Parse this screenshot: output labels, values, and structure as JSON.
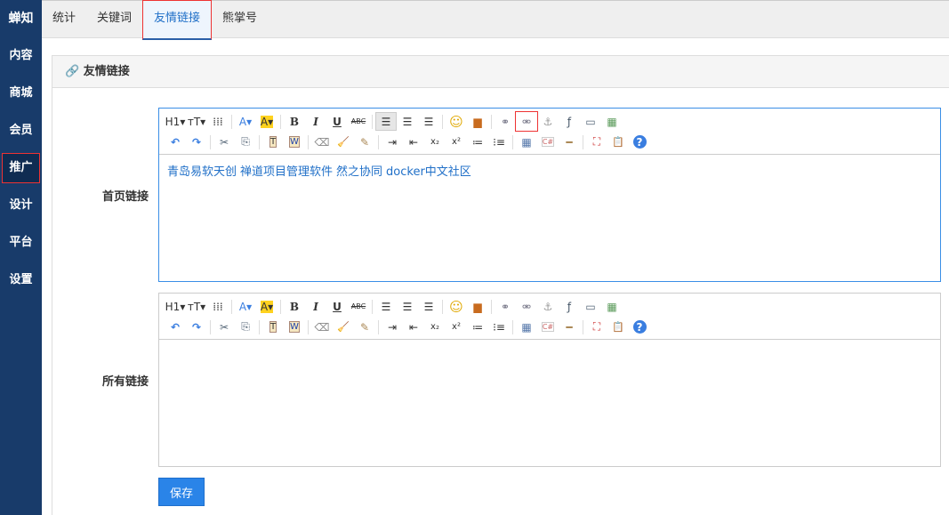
{
  "sidebar": {
    "brand": "蝉知",
    "items": [
      {
        "label": "内容"
      },
      {
        "label": "商城"
      },
      {
        "label": "会员"
      },
      {
        "label": "推广",
        "active": true
      },
      {
        "label": "设计"
      },
      {
        "label": "平台"
      },
      {
        "label": "设置"
      }
    ]
  },
  "topnav": {
    "tabs": [
      {
        "label": "统计"
      },
      {
        "label": "关键词"
      },
      {
        "label": "友情链接",
        "active": true
      },
      {
        "label": "熊掌号"
      }
    ]
  },
  "panel": {
    "title": "友情链接",
    "link_icon": "link-icon"
  },
  "form": {
    "home_label": "首页链接",
    "home_links": [
      "青岛易软天创",
      "禅道项目管理软件",
      "然之协同",
      "docker中文社区"
    ],
    "all_label": "所有链接",
    "save_label": "保存"
  },
  "toolbar": {
    "row1": [
      "heading",
      "font-size",
      "horizontal-rule",
      "|",
      "font-color",
      "highlight",
      "|",
      "bold",
      "italic",
      "underline",
      "strikethrough",
      "|",
      "align-left",
      "align-center",
      "align-right",
      "|",
      "emoticon",
      "image",
      "|",
      "link",
      "unlink",
      "anchor",
      "flash",
      "media",
      "image-manager"
    ],
    "row2": [
      "undo",
      "redo",
      "|",
      "cut",
      "copy",
      "|",
      "paste-text",
      "paste-word",
      "|",
      "eraser",
      "clear-format",
      "quick-format",
      "|",
      "indent",
      "outdent",
      "subscript",
      "superscript",
      "ordered-list",
      "unordered-list",
      "|",
      "table",
      "code",
      "insert-hr",
      "|",
      "fullscreen",
      "template",
      "help"
    ]
  },
  "colors": {
    "sidebar": "#183b6a",
    "accent": "#2170c8",
    "button": "#2a84e8"
  }
}
